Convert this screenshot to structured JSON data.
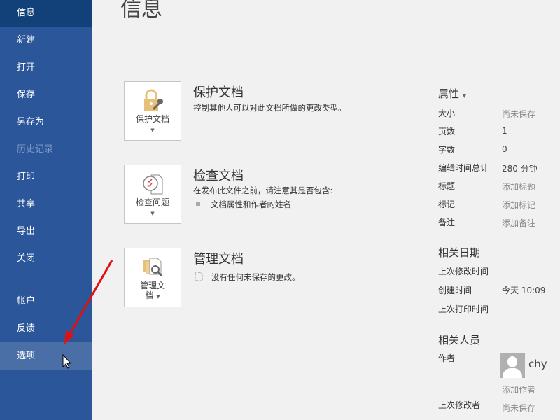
{
  "sidebar": {
    "items": [
      "信息",
      "新建",
      "打开",
      "保存",
      "另存为",
      "历史记录",
      "打印",
      "共享",
      "导出",
      "关闭",
      "帐户",
      "反馈",
      "选项"
    ]
  },
  "page_title": "信息",
  "protect": {
    "button": "保护文档",
    "heading": "保护文档",
    "desc": "控制其他人可以对此文档所做的更改类型。"
  },
  "inspect": {
    "button": "检查问题",
    "heading": "检查文档",
    "desc": "在发布此文件之前，请注意其是否包含:",
    "bullet": "文档属性和作者的姓名"
  },
  "manage": {
    "button_line1": "管理文",
    "button_line2": "档",
    "heading": "管理文档",
    "desc": "没有任何未保存的更改。"
  },
  "properties": {
    "heading": "属性",
    "rows": [
      {
        "label": "大小",
        "value": "尚未保存"
      },
      {
        "label": "页数",
        "value": "1"
      },
      {
        "label": "字数",
        "value": "0"
      },
      {
        "label": "编辑时间总计",
        "value": "280 分钟"
      },
      {
        "label": "标题",
        "value": "添加标题"
      },
      {
        "label": "标记",
        "value": "添加标记"
      },
      {
        "label": "备注",
        "value": "添加备注"
      }
    ]
  },
  "dates": {
    "heading": "相关日期",
    "rows": [
      {
        "label": "上次修改时间",
        "value": ""
      },
      {
        "label": "创建时间",
        "value": "今天 10:09"
      },
      {
        "label": "上次打印时间",
        "value": ""
      }
    ]
  },
  "people": {
    "heading": "相关人员",
    "author_label": "作者",
    "author_name": "chy",
    "add_author": "添加作者",
    "last_modified_label": "上次修改者",
    "last_modified_value": "尚未保存"
  },
  "colors": {
    "sidebar": "#2b579a",
    "arrow": "#e01010"
  }
}
